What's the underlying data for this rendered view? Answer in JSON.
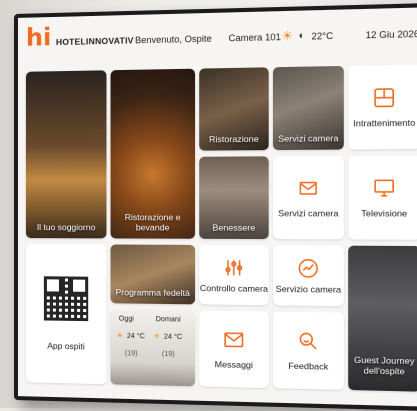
{
  "header": {
    "logo": "hi",
    "hotel_name": "HOTELINNOVATIV",
    "welcome": "Benvenuto, Ospite",
    "room": "Camera 101",
    "temperature": "22°C",
    "date": "12 Giu 2026"
  },
  "tiles": {
    "stay": "Il tuo soggiorno",
    "food": "Ristorazione e bevande",
    "restaurant": "Ristorazione",
    "room_services_photo": "Servizi camera",
    "entertainment": "Intrattenimento",
    "wellness": "Benessere",
    "room_services": "Servizi camera",
    "tv": "Televisione",
    "app": "App ospiti",
    "loyalty": "Programma fedeltà",
    "room_control": "Controllo camera",
    "room_service": "Servizio camera",
    "guest_journey": "Guest Journey dell'ospite",
    "messages": "Messaggi",
    "feedback": "Feedback"
  },
  "weather": {
    "today_label": "Oggi",
    "tomorrow_label": "Domani",
    "today_temp": "24 °C",
    "tomorrow_temp": "24 °C",
    "today_extra": "(19)",
    "tomorrow_extra": "(19)"
  },
  "colors": {
    "accent": "#ee6b1f"
  }
}
